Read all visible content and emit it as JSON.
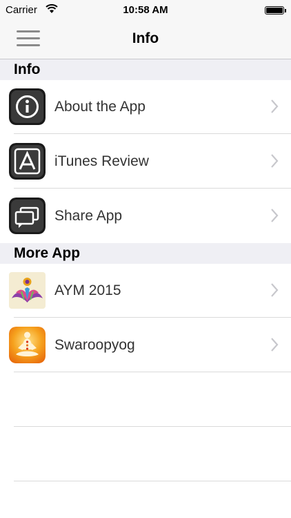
{
  "status_bar": {
    "carrier": "Carrier",
    "time": "10:58 AM"
  },
  "nav": {
    "title": "Info"
  },
  "sections": {
    "info_header": "Info",
    "more_header": "More App"
  },
  "info_items": [
    {
      "label": "About the App",
      "icon": "info-icon"
    },
    {
      "label": "iTunes Review",
      "icon": "app-store-icon"
    },
    {
      "label": "Share App",
      "icon": "chat-bubbles-icon"
    }
  ],
  "more_items": [
    {
      "label": "AYM 2015",
      "icon": "aym-app-icon"
    },
    {
      "label": "Swaroopyog",
      "icon": "meditation-icon"
    }
  ],
  "colors": {
    "bar_background": "#f7f7f7",
    "section_background": "#efeff4",
    "separator": "#dadada",
    "chevron": "#c7c7cc"
  }
}
